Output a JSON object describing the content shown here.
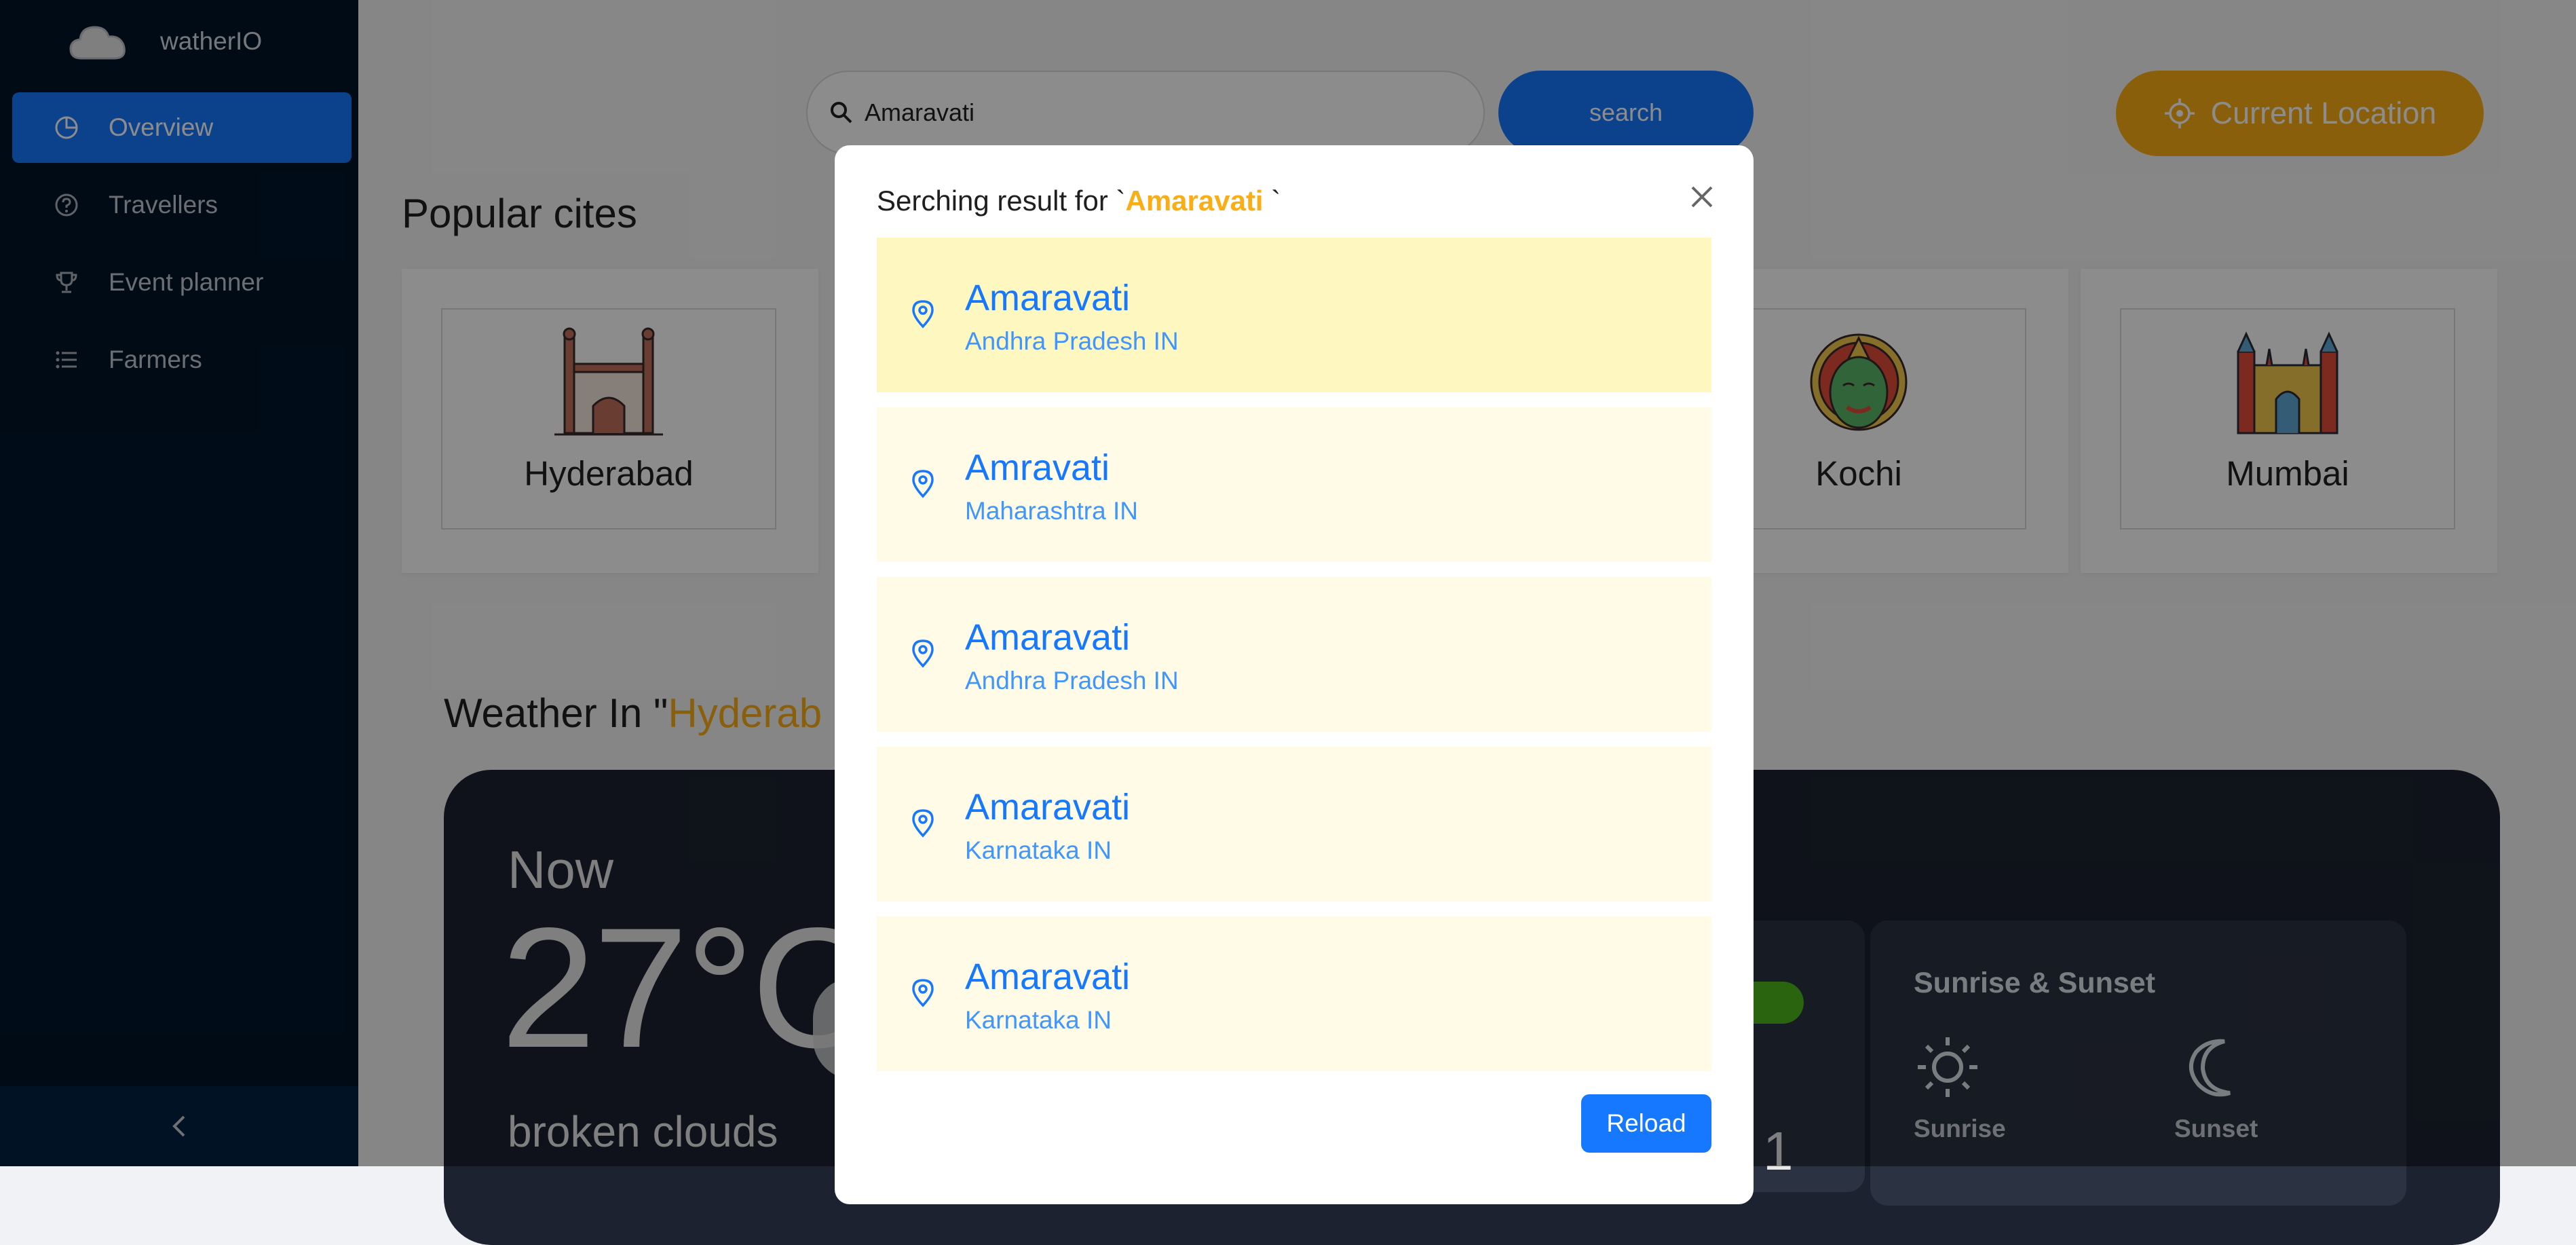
{
  "app": {
    "brand": "watherIO"
  },
  "sidebar": {
    "items": [
      {
        "label": "Overview",
        "icon": "pie-chart-icon",
        "active": true
      },
      {
        "label": "Travellers",
        "icon": "question-circle-icon",
        "active": false
      },
      {
        "label": "Event planner",
        "icon": "trophy-icon",
        "active": false
      },
      {
        "label": "Farmers",
        "icon": "list-icon",
        "active": false
      }
    ],
    "collapse_icon": "chevron-left-icon"
  },
  "search": {
    "value": "Amaravati",
    "button_label": "search"
  },
  "current_location": {
    "label": "Current Location"
  },
  "popular": {
    "title": "Popular cites",
    "cities": [
      "Hyderabad",
      "Kochi",
      "Mumbai"
    ]
  },
  "weather": {
    "title_prefix": "Weather In \"",
    "title_city": "Hyderab",
    "now_label": "Now",
    "temperature": "27°C",
    "description": "broken clouds",
    "partial_digit": "1",
    "sun_card": {
      "title": "Sunrise & Sunset",
      "sunrise_label": "Sunrise",
      "sunset_label": "Sunset"
    }
  },
  "modal": {
    "title_prefix": "Serching result for `",
    "query": "Amaravati",
    "title_suffix": " `",
    "results": [
      {
        "name": "Amaravati",
        "region": "Andhra Pradesh IN"
      },
      {
        "name": "Amravati",
        "region": "Maharashtra IN"
      },
      {
        "name": "Amaravati",
        "region": "Andhra Pradesh IN"
      },
      {
        "name": "Amaravati",
        "region": "Karnataka IN"
      },
      {
        "name": "Amaravati",
        "region": "Karnataka IN"
      }
    ],
    "reload_label": "Reload"
  },
  "colors": {
    "accent": "#1677ff",
    "highlight": "#faad14",
    "sidebar_bg": "#001529",
    "result_bg": "#fffbe6",
    "result_selected_bg": "#fff7c0"
  }
}
